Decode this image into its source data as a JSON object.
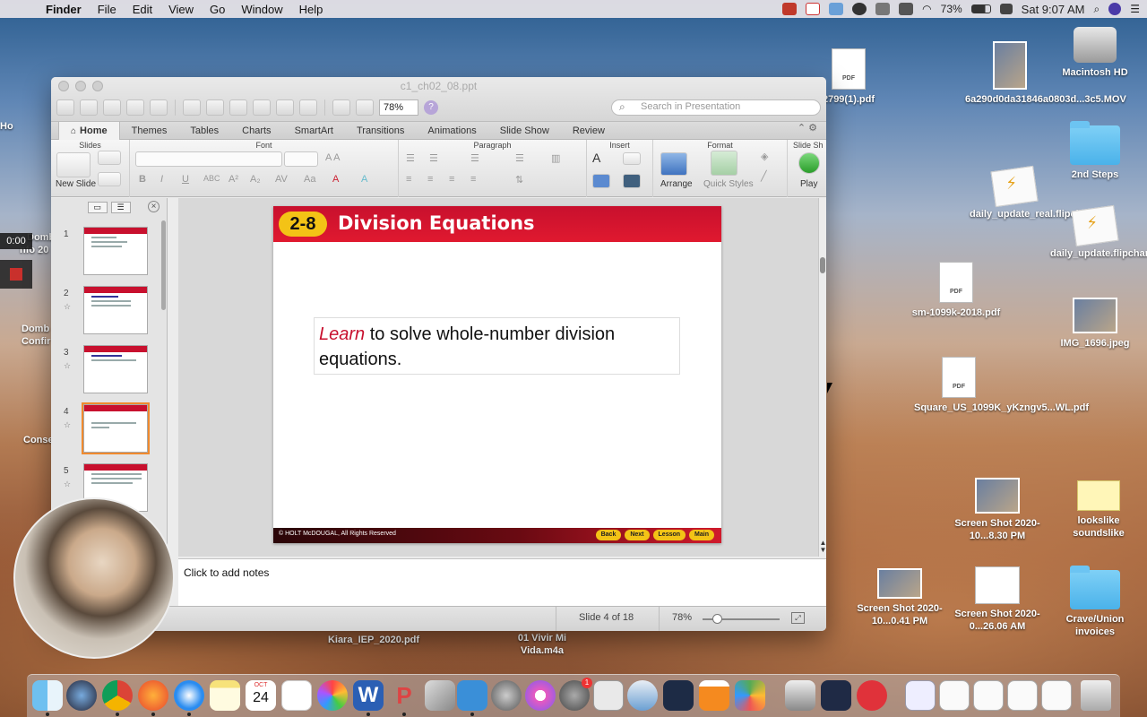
{
  "menubar": {
    "app": "Finder",
    "items": [
      "File",
      "Edit",
      "View",
      "Go",
      "Window",
      "Help"
    ],
    "battery": "73%",
    "clock": "Sat 9:07 AM"
  },
  "desktop_icons": [
    {
      "label": "Macintosh HD",
      "kind": "hd"
    },
    {
      "label": "6a290d0da31846a0803d...3c5.MOV",
      "kind": "thumb"
    },
    {
      "label": "2799(1).pdf",
      "kind": "doc",
      "tag": "PDF"
    },
    {
      "label": "2nd Steps",
      "kind": "folder"
    },
    {
      "label": "daily_update_real.flipchart",
      "kind": "flip"
    },
    {
      "label": "daily_update.flipchart",
      "kind": "flip"
    },
    {
      "label": "sm-1099k-2018.pdf",
      "kind": "doc",
      "tag": "PDF"
    },
    {
      "label": "IMG_1696.jpeg",
      "kind": "thumb"
    },
    {
      "label": "Square_US_1099K_yKzngv5...WL.pdf",
      "kind": "doc",
      "tag": "PDF"
    },
    {
      "label": "Screen Shot 2020-10...8.30 PM",
      "kind": "thumb"
    },
    {
      "label": "lookslike soundslike",
      "kind": "env"
    },
    {
      "label": "Screen Shot 2020-10...0.41 PM",
      "kind": "thumb"
    },
    {
      "label": "Screen Shot 2020-0...26.06 AM",
      "kind": "thumb"
    },
    {
      "label": "Crave/Union invoices",
      "kind": "folder"
    },
    {
      "label": "Kiara_IEP_2020.pdf",
      "kind": "none"
    },
    {
      "label": "01 Vivir Mi Vida.m4a",
      "kind": "none"
    }
  ],
  "left_partial": {
    "labels": [
      "Ho",
      "Domb",
      "nfo 20",
      "Domb",
      "Confir",
      "Conse"
    ],
    "recorder_time": "0:00"
  },
  "ppt": {
    "doc_title": "c1_ch02_08.ppt",
    "zoom": "78%",
    "search_placeholder": "Search in Presentation",
    "tabs": [
      "Home",
      "Themes",
      "Tables",
      "Charts",
      "SmartArt",
      "Transitions",
      "Animations",
      "Slide Show",
      "Review"
    ],
    "groups": [
      "Slides",
      "Font",
      "Paragraph",
      "Insert",
      "Format",
      "Slide Sh"
    ],
    "buttons": {
      "new_slide": "New Slide",
      "arrange": "Arrange",
      "quick_styles": "Quick Styles",
      "play": "Play"
    },
    "slides": [
      {
        "num": "1"
      },
      {
        "num": "2"
      },
      {
        "num": "3"
      },
      {
        "num": "4",
        "selected": true
      },
      {
        "num": "5"
      }
    ],
    "current_slide": {
      "badge": "2-8",
      "title": "Division Equations",
      "keyword": "Learn",
      "body": " to solve whole-number division equations.",
      "footer": "© HOLT McDOUGAL, All Rights Reserved",
      "nav": [
        "Back",
        "Next",
        "Lesson",
        "Main"
      ]
    },
    "notes_placeholder": "Click to add notes",
    "status": {
      "slide_of": "Slide 4 of 18",
      "zoom": "78%"
    }
  },
  "dock": {
    "calendar_month": "OCT",
    "calendar_day": "24",
    "badge_count": "1",
    "apps": [
      "Finder",
      "Siri",
      "Chrome",
      "Firefox",
      "Safari",
      "Notes",
      "Calendar",
      "Reminders",
      "Photos",
      "Word",
      "PowerPoint",
      "Preview",
      "Pages",
      "Launchpad",
      "iTunes",
      "System Preferences",
      "Screenshot",
      "Migration",
      "Xcode",
      "VLC",
      "Tiles",
      "Preview 2",
      "Screen Recorder",
      "No Entry"
    ]
  },
  "colors": {
    "accent_red": "#c8102e",
    "badge_yellow": "#f3c316"
  }
}
